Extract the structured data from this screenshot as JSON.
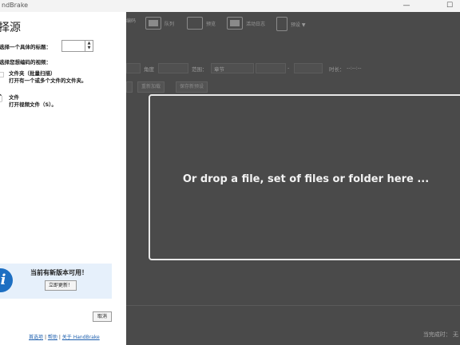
{
  "window": {
    "title": "ndBrake",
    "minimize_glyph": "—",
    "maximize_glyph": "☐"
  },
  "toolbar": {
    "items": [
      {
        "label": "编码",
        "icon": "encode-icon"
      },
      {
        "label": "队列",
        "icon": "queue-icon"
      },
      {
        "label": "预览",
        "icon": "preview-icon"
      },
      {
        "label": "活动日志",
        "icon": "activity-log-icon"
      },
      {
        "label": "预设 ▼",
        "icon": "presets-icon"
      }
    ]
  },
  "source_row": {
    "angle_label": "角度",
    "range_label": "范围：",
    "range_value": "章节",
    "dash": "-",
    "duration_label": "时长：",
    "duration_value": "--:--:--"
  },
  "action_buttons": {
    "reload": "重新加载",
    "save_preset": "保存新预设"
  },
  "dropzone": {
    "message": "Or drop a file, set of files or folder here ..."
  },
  "status": {
    "when_done_label": "当完成时：  无"
  },
  "source_panel": {
    "heading": "择源",
    "title_select_label": "选择一个具体的标题：",
    "choose_label": "选择您想编码的视频：",
    "options": [
      {
        "title": "文件夹（批量扫描）",
        "desc": "打开有一个或多个文件的文件夹。",
        "icon": "folder-icon"
      },
      {
        "title": "文件",
        "desc": "打开视频文件（S）。",
        "icon": "file-icon"
      }
    ],
    "update": {
      "text": "当前有新版本可用！",
      "button": "立即更新！"
    },
    "cancel_button": "取消",
    "links": {
      "preferences": "首选项",
      "separator": "|",
      "help": "帮助",
      "about": "关于 HandBrake"
    }
  }
}
